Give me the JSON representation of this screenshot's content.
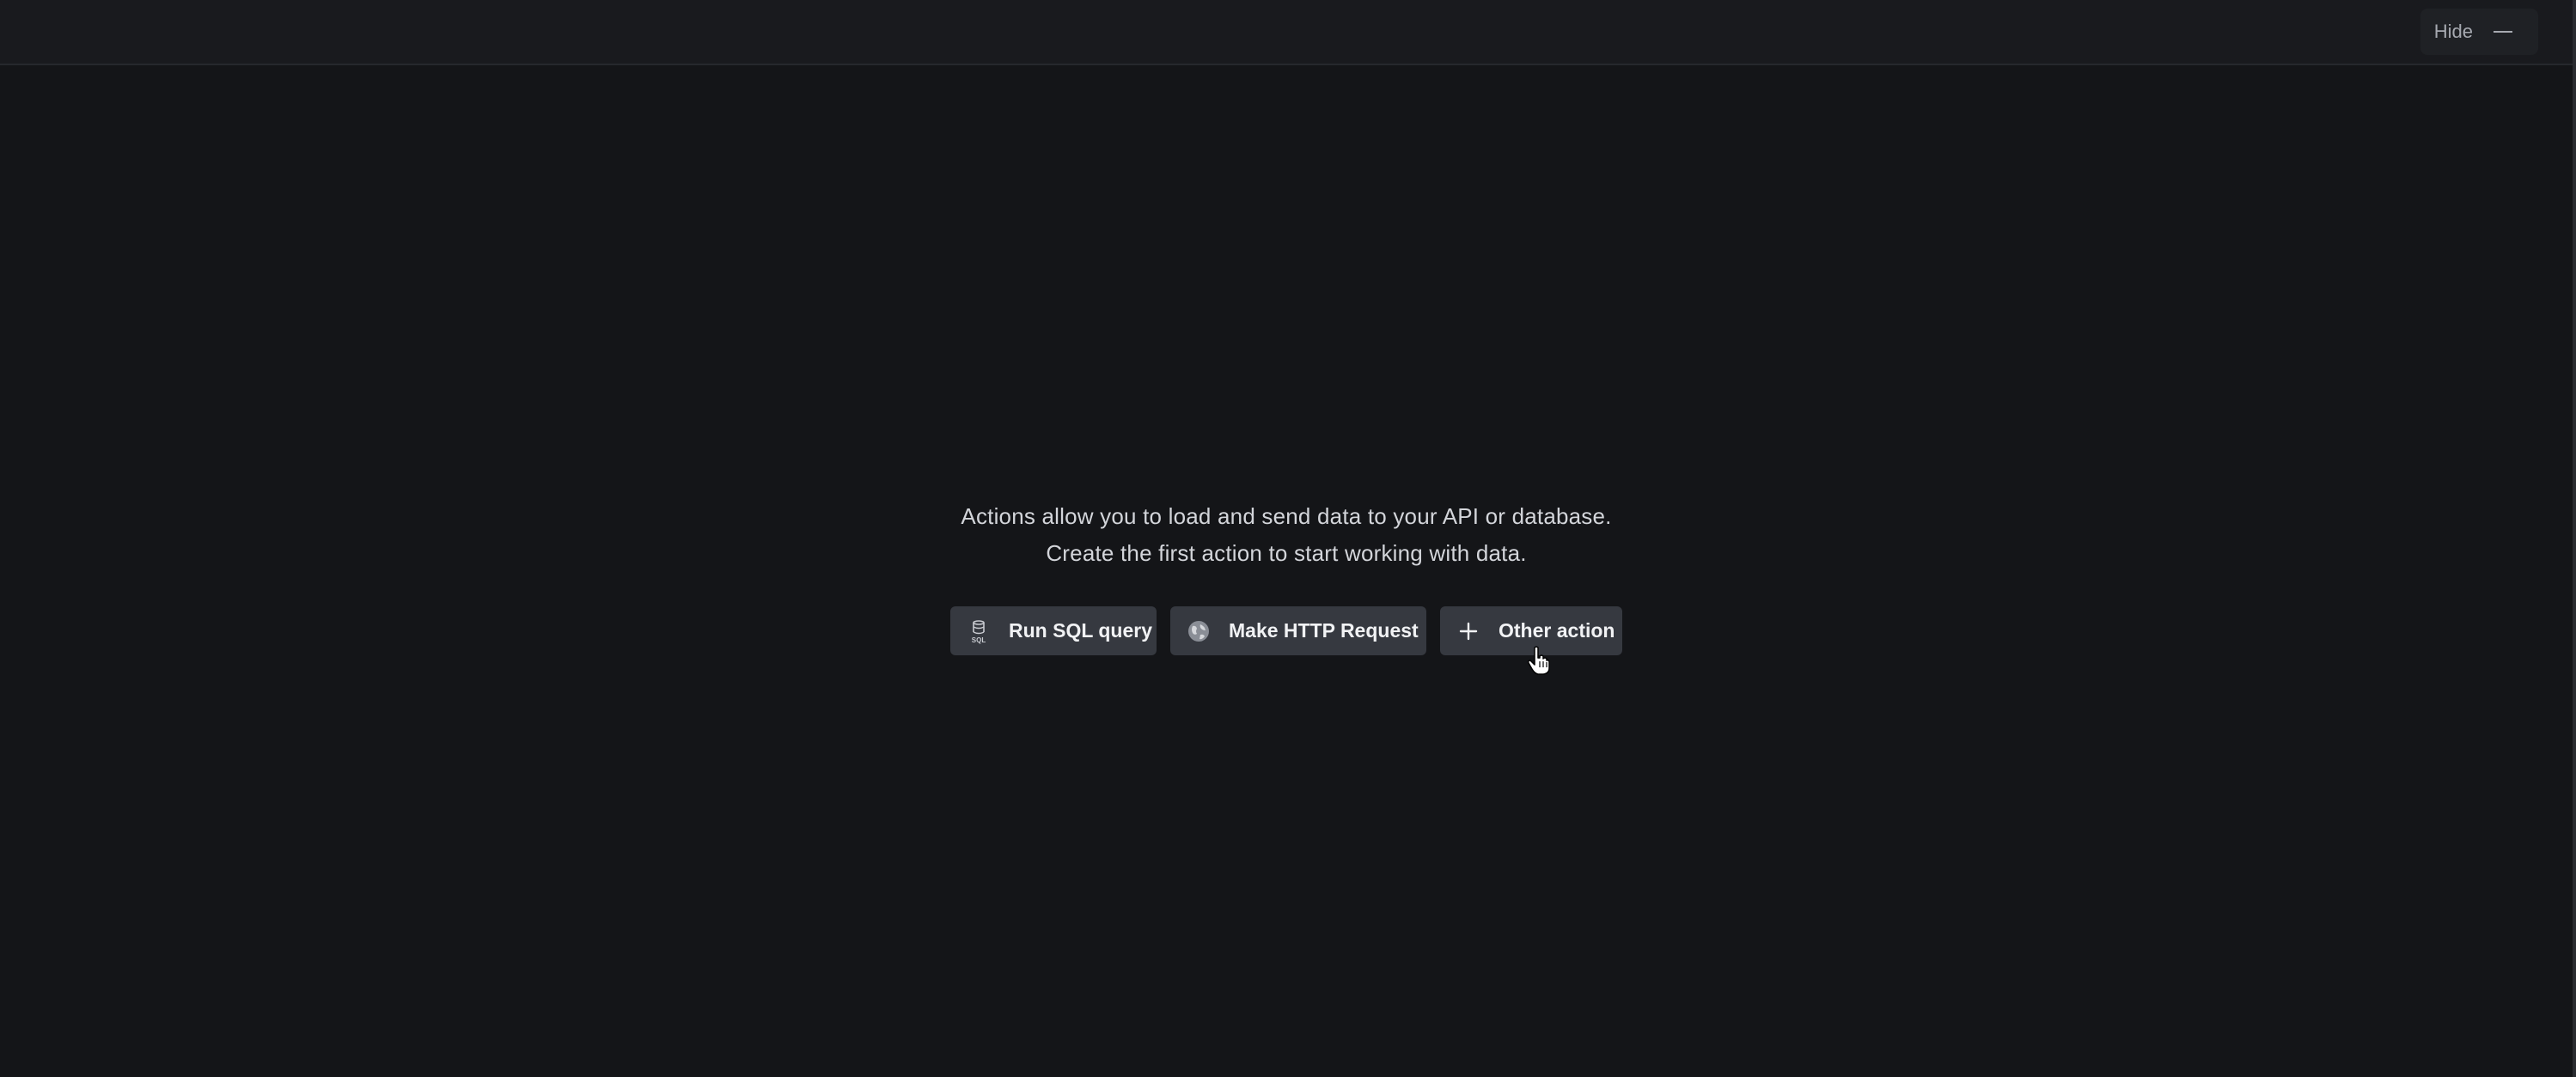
{
  "header": {
    "hide_label": "Hide",
    "hide_icon": "minus-icon"
  },
  "empty_state": {
    "line1": "Actions allow you to load and send data to your API or database.",
    "line2": "Create the first action to start working with data."
  },
  "actions": [
    {
      "label": "Run SQL query",
      "icon": "sql-database-icon"
    },
    {
      "label": "Make HTTP Request",
      "icon": "globe-icon"
    },
    {
      "label": "Other action",
      "icon": "plus-icon"
    }
  ],
  "colors": {
    "background": "#141518",
    "topbar": "#191a1e",
    "button": "#363940",
    "text": "#d3d5da"
  }
}
